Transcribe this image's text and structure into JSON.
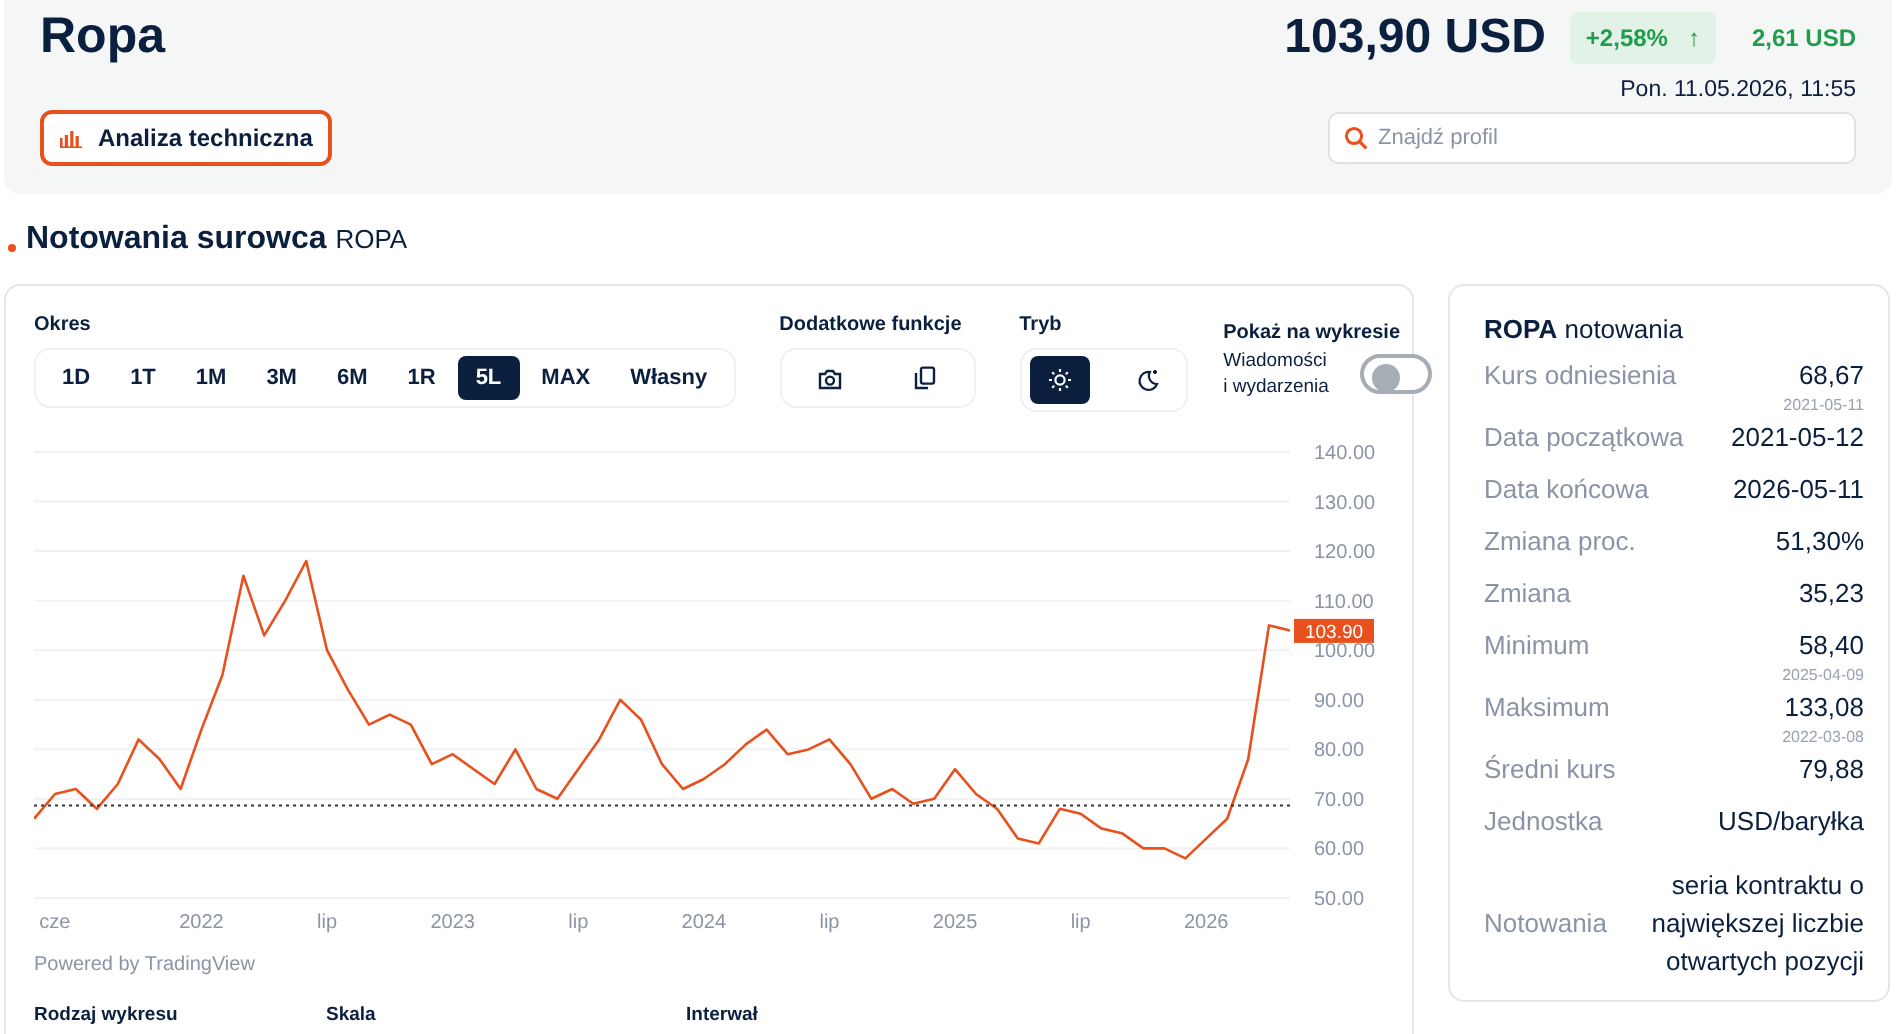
{
  "header": {
    "title": "Ropa",
    "price": "103,90 USD",
    "change_percent": "+2,58%",
    "change_arrow": "↑",
    "change_value": "2,61 USD",
    "timestamp": "Pon. 11.05.2026, 11:55",
    "analysis_button": "Analiza techniczna",
    "search": {
      "placeholder": "Znajdź profil"
    }
  },
  "section": {
    "title": "Notowania surowca",
    "subtitle": "ROPA"
  },
  "controls": {
    "period_label": "Okres",
    "periods": [
      {
        "label": "1D",
        "selected": false
      },
      {
        "label": "1T",
        "selected": false
      },
      {
        "label": "1M",
        "selected": false
      },
      {
        "label": "3M",
        "selected": false
      },
      {
        "label": "6M",
        "selected": false
      },
      {
        "label": "1R",
        "selected": false
      },
      {
        "label": "5L",
        "selected": true
      },
      {
        "label": "MAX",
        "selected": false
      },
      {
        "label": "Własny",
        "selected": false
      }
    ],
    "functions_label": "Dodatkowe funkcje",
    "functions": [
      {
        "kind": "camera"
      },
      {
        "kind": "copy"
      }
    ],
    "mode_label": "Tryb",
    "modes": [
      {
        "kind": "light",
        "selected": true
      },
      {
        "kind": "dark",
        "selected": false
      }
    ],
    "show_label": "Pokaż na wykresie",
    "news_toggle": {
      "label_1": "Wiadomości",
      "label_2": "i wydarzenia",
      "on": false
    }
  },
  "chart": {
    "chart_data": {
      "type": "line",
      "categories": [
        null,
        "cze",
        null,
        null,
        null,
        null,
        null,
        null,
        "2022",
        null,
        null,
        null,
        null,
        null,
        "lip",
        null,
        null,
        null,
        null,
        null,
        "2023",
        null,
        null,
        null,
        null,
        null,
        "lip",
        null,
        null,
        null,
        null,
        null,
        "2024",
        null,
        null,
        null,
        null,
        null,
        "lip",
        null,
        null,
        null,
        null,
        null,
        "2025",
        null,
        null,
        null,
        null,
        null,
        "lip",
        null,
        null,
        null,
        null,
        null,
        "2026",
        null,
        null,
        null,
        null
      ],
      "series": [
        {
          "color": "#e8501e",
          "line_style": "solid",
          "values": [
            66,
            71,
            72,
            68,
            73,
            82,
            78,
            72,
            84,
            95,
            115,
            103,
            110,
            118,
            100,
            92,
            85,
            87,
            85,
            77,
            79,
            76,
            73,
            80,
            72,
            70,
            76,
            82,
            90,
            86,
            77,
            72,
            74,
            77,
            81,
            84,
            79,
            80,
            82,
            77,
            70,
            72,
            69,
            70,
            76,
            71,
            68,
            62,
            61,
            68,
            67,
            64,
            63,
            60,
            60,
            58,
            62,
            66,
            78,
            105,
            104
          ]
        },
        {
          "color": "#333344",
          "line_style": "dotted",
          "values": [
            68.7,
            68.7,
            68.7,
            68.7,
            68.7,
            68.7,
            68.7,
            68.7,
            68.7,
            68.7,
            68.7,
            68.7,
            68.7,
            68.7,
            68.7,
            68.7,
            68.7,
            68.7,
            68.7,
            68.7,
            68.7,
            68.7,
            68.7,
            68.7,
            68.7,
            68.7,
            68.7,
            68.7,
            68.7,
            68.7,
            68.7,
            68.7,
            68.7,
            68.7,
            68.7,
            68.7,
            68.7,
            68.7,
            68.7,
            68.7,
            68.7,
            68.7,
            68.7,
            68.7,
            68.7,
            68.7,
            68.7,
            68.7,
            68.7,
            68.7,
            68.7,
            68.7,
            68.7,
            68.7,
            68.7,
            68.7,
            68.7,
            68.7,
            68.7,
            68.7,
            68.7
          ]
        }
      ],
      "grid": true,
      "ylim": [
        50,
        140
      ],
      "yticks": [
        {
          "value": 50,
          "label": "50.00"
        },
        {
          "value": 60,
          "label": "60.00"
        },
        {
          "value": 70,
          "label": "70.00"
        },
        {
          "value": 80,
          "label": "80.00"
        },
        {
          "value": 90,
          "label": "90.00"
        },
        {
          "value": 100,
          "label": "100.00"
        },
        {
          "value": 110,
          "label": "110.00"
        },
        {
          "value": 120,
          "label": "120.00"
        },
        {
          "value": 130,
          "label": "130.00"
        },
        {
          "value": 140,
          "label": "140.00"
        }
      ],
      "annotations": [
        {
          "y": 103.9,
          "text": "103.90"
        }
      ]
    },
    "credit": "Powered by TradingView"
  },
  "bottom_labels": [
    "Rodzaj wykresu",
    "Skala",
    "Interwał"
  ],
  "stats": {
    "title": "ROPA",
    "title_suffix": "notowania",
    "rows": [
      {
        "label": "Kurs odniesienia",
        "value": "68,67",
        "date": "2021-05-11"
      },
      {
        "label": "Data początkowa",
        "value": "2021-05-12"
      },
      {
        "label": "Data końcowa",
        "value": "2026-05-11"
      },
      {
        "label": "Zmiana proc.",
        "value": "51,30%"
      },
      {
        "label": "Zmiana",
        "value": "35,23"
      },
      {
        "label": "Minimum",
        "value": "58,40",
        "date": "2025-04-09"
      },
      {
        "label": "Maksimum",
        "value": "133,08",
        "date": "2022-03-08"
      },
      {
        "label": "Średni kurs",
        "value": "79,88"
      },
      {
        "label": "Jednostka",
        "value": "USD/baryłka"
      },
      {
        "label": "Notowania",
        "value": "seria kontraktu o największej liczbie otwartych pozycji"
      }
    ]
  }
}
